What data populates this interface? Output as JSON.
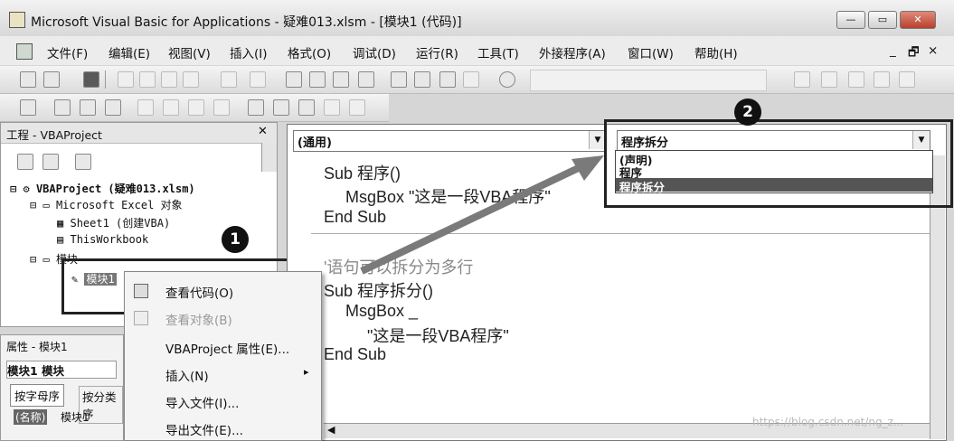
{
  "window": {
    "title": "Microsoft Visual Basic for Applications - 疑难013.xlsm - [模块1 (代码)]",
    "controls": [
      "—",
      "▭",
      "✕"
    ]
  },
  "menu": {
    "items": [
      "文件(F)",
      "编辑(E)",
      "视图(V)",
      "插入(I)",
      "格式(O)",
      "调试(D)",
      "运行(R)",
      "工具(T)",
      "外接程序(A)",
      "窗口(W)",
      "帮助(H)"
    ],
    "mdi_controls": [
      "_",
      "🗗",
      "×"
    ]
  },
  "project": {
    "title": "工程 - VBAProject",
    "close": "✕",
    "tree": {
      "root": "VBAProject (疑难013.xlsm)",
      "excel_objects": "Microsoft Excel 对象",
      "sheet1": "Sheet1 (创建VBA)",
      "thisworkbook": "ThisWorkbook",
      "modules": "模块",
      "module1": "模块1"
    }
  },
  "properties": {
    "title": "属性 - 模块1",
    "object": "模块1 模块",
    "tab_alpha": "按字母序",
    "tab_cat": "按分类序",
    "name_key": "(名称)",
    "name_value": "模块1"
  },
  "code": {
    "object_combo": "(通用)",
    "proc_combo": "程序拆分",
    "dropdown_options": [
      "(声明)",
      "程序",
      "程序拆分"
    ],
    "lines1": [
      "Sub 程序()",
      "MsgBox \"这是一段VBA程序\"",
      "End Sub"
    ],
    "lines2": [
      "'语句可以拆分为多行",
      "Sub 程序拆分()",
      "MsgBox _",
      "\"这是一段VBA程序\"",
      "End Sub"
    ]
  },
  "context_menu": {
    "items": [
      "查看代码(O)",
      "查看对象(B)",
      "VBAProject 属性(E)...",
      "插入(N)",
      "导入文件(I)...",
      "导出文件(E)..."
    ],
    "submenu_arrow": "▸"
  },
  "callouts": [
    "1",
    "2"
  ],
  "watermark": "https://blog.csdn.net/ng_z..."
}
